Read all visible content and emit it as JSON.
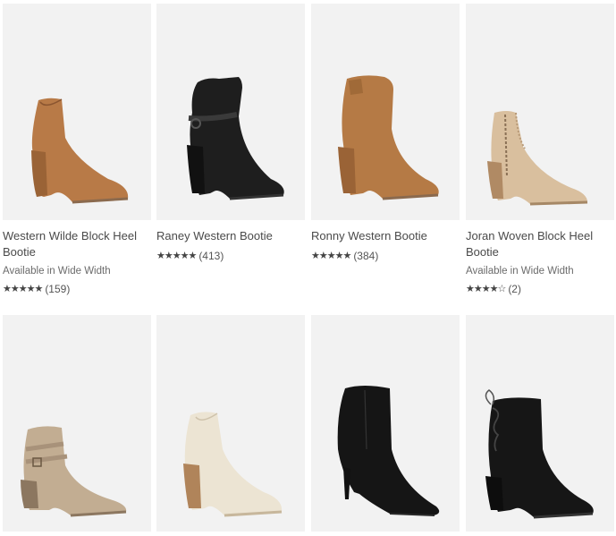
{
  "products": [
    {
      "name": "Western Wilde Block Heel Bootie",
      "availability": "Available in Wide Width",
      "stars": "★★★★★",
      "review_count": "(159)",
      "color": "#b87a47",
      "style": "ankle"
    },
    {
      "name": "Raney Western Bootie",
      "availability": "",
      "stars": "★★★★★",
      "review_count": "(413)",
      "color": "#1e1e1e",
      "style": "western-strap"
    },
    {
      "name": "Ronny Western Bootie",
      "availability": "",
      "stars": "★★★★★",
      "review_count": "(384)",
      "color": "#b57a45",
      "style": "western"
    },
    {
      "name": "Joran Woven Block Heel Bootie",
      "availability": "Available in Wide Width",
      "stars": "★★★★☆",
      "review_count": "(2)",
      "color": "#d9bf9e",
      "style": "woven"
    },
    {
      "name": "",
      "availability": "",
      "stars": "",
      "review_count": "",
      "color": "#c2ad92",
      "style": "strappy"
    },
    {
      "name": "",
      "availability": "",
      "stars": "",
      "review_count": "",
      "color": "#ece4d3",
      "style": "ankle"
    },
    {
      "name": "",
      "availability": "",
      "stars": "",
      "review_count": "",
      "color": "#151515",
      "style": "stiletto"
    },
    {
      "name": "",
      "availability": "",
      "stars": "",
      "review_count": "",
      "color": "#161616",
      "style": "laceback"
    }
  ],
  "rating_values": [
    4.5,
    4.5,
    4.5,
    4.0
  ]
}
